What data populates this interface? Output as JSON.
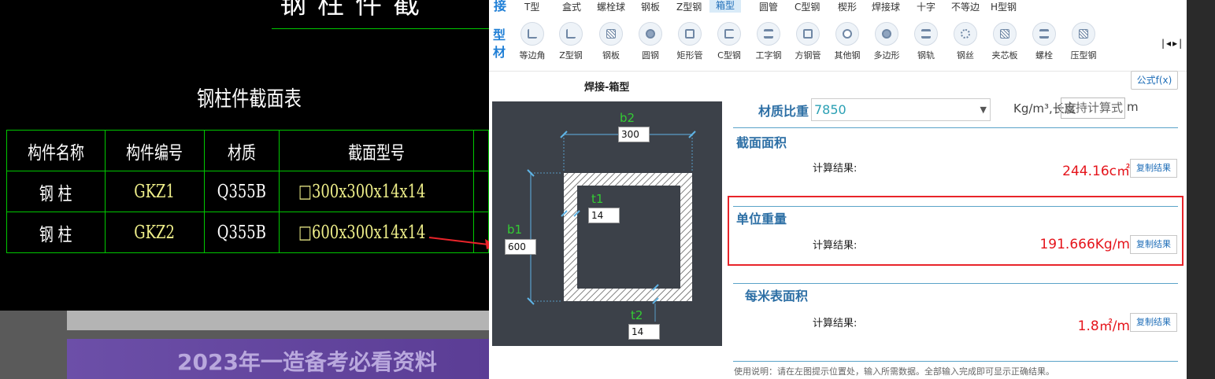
{
  "cad": {
    "top_fragment": "钢柱件截",
    "table_title": "钢柱件截面表",
    "headers": [
      "构件名称",
      "构件编号",
      "材质",
      "截面型号"
    ],
    "rows": [
      {
        "name": "钢 柱",
        "code": "GKZ1",
        "material": "Q355B",
        "section": "□300x300x14x14"
      },
      {
        "name": "钢 柱",
        "code": "GKZ2",
        "material": "Q355B",
        "section": "□600x300x14x14"
      }
    ]
  },
  "banner": {
    "text": "2023年一造备考必看资料"
  },
  "panel": {
    "top_tabs": {
      "prefix": "接",
      "items": [
        "T型",
        "盒式",
        "螺栓球",
        "钢板",
        "Z型钢",
        "箱型",
        "圆管",
        "C型钢",
        "楔形",
        "焊接球",
        "十字",
        "不等边",
        "H型钢"
      ],
      "active": "箱型"
    },
    "profile_label": "型材",
    "profile_items": [
      "等边角",
      "Z型钢",
      "钢板",
      "圆钢",
      "矩形管",
      "C型钢",
      "工字钢",
      "方钢管",
      "其他钢",
      "多边形",
      "钢轨",
      "钢丝",
      "夹芯板",
      "螺栓",
      "压型钢"
    ],
    "formula_button": "公式f(x)",
    "diagram_title": "焊接-箱型",
    "dims": {
      "b2_label": "b2",
      "b2_value": "300",
      "b1_label": "b1",
      "b1_value": "600",
      "t1_label": "t1",
      "t1_value": "14",
      "t2_label": "t2",
      "t2_value": "14"
    },
    "material": {
      "label": "材质比重",
      "value": "7850",
      "unit_text": "Kg/m³,长度",
      "length_placeholder": "支持计算式",
      "length_unit": "m"
    },
    "sections": [
      {
        "title": "截面面积",
        "calc_label": "计算结果:",
        "value": "244.16c㎡",
        "copy": "复制结果"
      },
      {
        "title": "单位重量",
        "calc_label": "计算结果:",
        "value": "191.666Kg/m",
        "copy": "复制结果"
      },
      {
        "title": "每米表面积",
        "calc_label": "计算结果:",
        "value": "1.8㎡/m",
        "copy": "复制结果"
      }
    ],
    "usage": "使用说明：请在左图提示位置处，输入所需数据。全部输入完成即可显示正确结果。"
  },
  "colors": {
    "accent": "#1f7fd6",
    "result": "#e5141b",
    "cad_grid": "#00c800",
    "highlight": "#e8242a"
  }
}
